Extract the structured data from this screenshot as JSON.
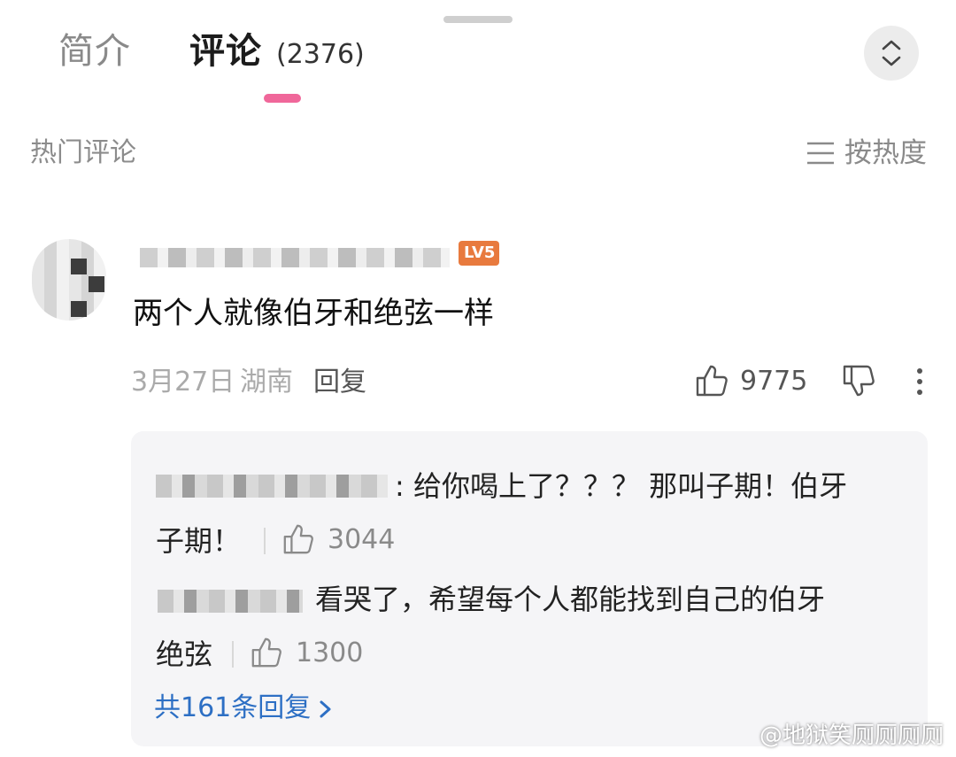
{
  "tabs": {
    "intro_label": "简介",
    "comments_label": "评论",
    "comments_count": "(2376)"
  },
  "section": {
    "hot_label": "热门评论",
    "sort_label": "按热度"
  },
  "comment": {
    "text": "两个人就像伯牙和绝弦一样",
    "date": "3月27日",
    "region": "湖南",
    "reply_label": "回复",
    "likes": "9775",
    "badge_text": "LV5"
  },
  "replies": [
    {
      "text_line1": ": 给你喝上了？？？ 那叫子期！伯牙",
      "text_line2": "子期！",
      "likes": "3044"
    },
    {
      "text_line1": "看哭了，希望每个人都能找到自己的伯牙",
      "text_line2": "绝弦",
      "likes": "1300"
    }
  ],
  "more_replies_label": "共161条回复",
  "watermark": "@地狱笑厕厕厕厕",
  "colors": {
    "accent_pink": "#f0679a",
    "link_blue": "#2d6fc4",
    "badge_orange": "#e87a3e"
  },
  "icons": [
    "collapse-chevrons-icon",
    "sort-lines-icon",
    "thumb-up-icon",
    "thumb-down-icon",
    "more-dots-icon",
    "chevron-right-icon"
  ]
}
